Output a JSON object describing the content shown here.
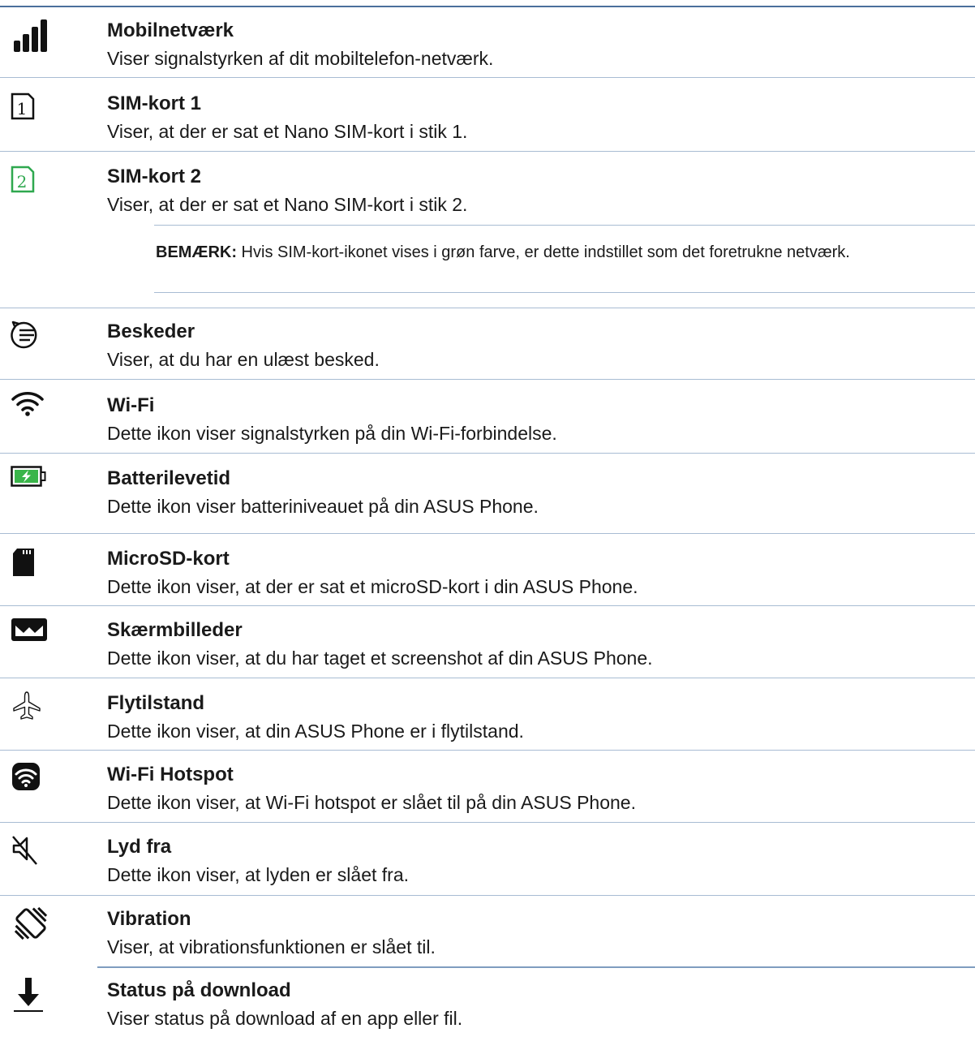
{
  "items": [
    {
      "icon": "signal-bars-icon",
      "title": "Mobilnetværk",
      "desc": "Viser signalstyrken af dit mobiltelefon-netværk."
    },
    {
      "icon": "sim-card-1-icon",
      "icon_text": "1",
      "title": "SIM-kort 1",
      "desc": "Viser, at der er sat et Nano SIM-kort i stik 1."
    },
    {
      "icon": "sim-card-2-icon",
      "icon_text": "2",
      "title": "SIM-kort 2",
      "desc": "Viser, at der er sat et Nano SIM-kort i stik 2."
    },
    {
      "icon": "message-icon",
      "title": "Beskeder",
      "desc": "Viser, at du har en ulæst besked."
    },
    {
      "icon": "wifi-icon",
      "title": "Wi-Fi",
      "desc": "Dette ikon viser signalstyrken på din Wi-Fi-forbindelse."
    },
    {
      "icon": "battery-icon",
      "title": "Batterilevetid",
      "desc": "Dette ikon viser batteriniveauet på din ASUS Phone."
    },
    {
      "icon": "microsd-card-icon",
      "title": "MicroSD-kort",
      "desc": "Dette ikon viser, at der er sat et microSD-kort i din ASUS Phone."
    },
    {
      "icon": "screenshot-icon",
      "title": "Skærmbilleder",
      "desc": "Dette ikon viser, at du har taget et screenshot af din ASUS Phone."
    },
    {
      "icon": "airplane-icon",
      "title": "Flytilstand",
      "desc": "Dette ikon viser, at din ASUS Phone er i flytilstand."
    },
    {
      "icon": "wifi-hotspot-icon",
      "title": "Wi-Fi Hotspot",
      "desc": "Dette ikon viser, at Wi-Fi hotspot er slået til på din ASUS Phone."
    },
    {
      "icon": "mute-icon",
      "title": "Lyd fra",
      "desc": "Dette ikon viser, at lyden er slået fra."
    },
    {
      "icon": "vibration-icon",
      "title": "Vibration",
      "desc": "Viser, at vibrationsfunktionen er slået til."
    },
    {
      "icon": "download-icon",
      "title": "Status på download",
      "desc": "Viser status på download af en app eller fil."
    }
  ],
  "note": {
    "label": "BEMÆRK:",
    "text": " Hvis SIM-kort-ikonet vises i grøn farve, er dette indstillet som det foretrukne netværk."
  },
  "colors": {
    "rule": "#a8bcd3",
    "rule_dark": "#4a6f9c",
    "sim_green": "#2fa84f",
    "battery_green": "#3ab54a"
  }
}
